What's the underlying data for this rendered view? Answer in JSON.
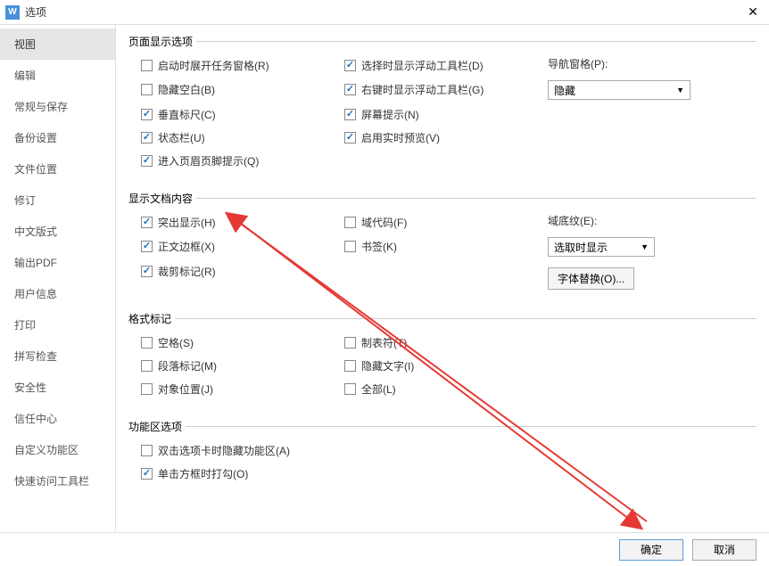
{
  "title": "选项",
  "sidebar": {
    "items": [
      {
        "label": "视图",
        "active": true
      },
      {
        "label": "编辑"
      },
      {
        "label": "常规与保存"
      },
      {
        "label": "备份设置"
      },
      {
        "label": "文件位置"
      },
      {
        "label": "修订"
      },
      {
        "label": "中文版式"
      },
      {
        "label": "输出PDF"
      },
      {
        "label": "用户信息"
      },
      {
        "label": "打印"
      },
      {
        "label": "拼写检查"
      },
      {
        "label": "安全性"
      },
      {
        "label": "信任中心"
      },
      {
        "label": "自定义功能区"
      },
      {
        "label": "快速访问工具栏"
      }
    ]
  },
  "groups": {
    "page_display": {
      "legend": "页面显示选项",
      "open_task_pane": {
        "label": "启动时展开任务窗格(R)",
        "checked": false
      },
      "hide_blank": {
        "label": "隐藏空白(B)",
        "checked": false
      },
      "vertical_ruler": {
        "label": "垂直标尺(C)",
        "checked": true
      },
      "status_bar": {
        "label": "状态栏(U)",
        "checked": true
      },
      "header_footer_tip": {
        "label": "进入页眉页脚提示(Q)",
        "checked": true
      },
      "float_toolbar_select": {
        "label": "选择时显示浮动工具栏(D)",
        "checked": true
      },
      "float_toolbar_rclick": {
        "label": "右键时显示浮动工具栏(G)",
        "checked": true
      },
      "screen_tip": {
        "label": "屏幕提示(N)",
        "checked": true
      },
      "live_preview": {
        "label": "启用实时预览(V)",
        "checked": true
      },
      "nav_pane_label": "导航窗格(P):",
      "nav_pane_value": "隐藏"
    },
    "doc_content": {
      "legend": "显示文档内容",
      "highlight": {
        "label": "突出显示(H)",
        "checked": true
      },
      "text_border": {
        "label": "正文边框(X)",
        "checked": true
      },
      "crop_marks": {
        "label": "裁剪标记(R)",
        "checked": true
      },
      "field_code": {
        "label": "域代码(F)",
        "checked": false
      },
      "bookmark": {
        "label": "书签(K)",
        "checked": false
      },
      "field_shade_label": "域底纹(E):",
      "field_shade_value": "选取时显示",
      "font_replace": "字体替换(O)..."
    },
    "format_marks": {
      "legend": "格式标记",
      "space": {
        "label": "空格(S)",
        "checked": false
      },
      "paragraph": {
        "label": "段落标记(M)",
        "checked": false
      },
      "object_pos": {
        "label": "对象位置(J)",
        "checked": false
      },
      "tab": {
        "label": "制表符(T)",
        "checked": false
      },
      "hidden_text": {
        "label": "隐藏文字(I)",
        "checked": false
      },
      "all": {
        "label": "全部(L)",
        "checked": false
      }
    },
    "ribbon": {
      "legend": "功能区选项",
      "dblclick_hide": {
        "label": "双击选项卡时隐藏功能区(A)",
        "checked": false
      },
      "click_check": {
        "label": "单击方框时打勾(O)",
        "checked": true
      }
    }
  },
  "footer": {
    "ok": "确定",
    "cancel": "取消"
  }
}
